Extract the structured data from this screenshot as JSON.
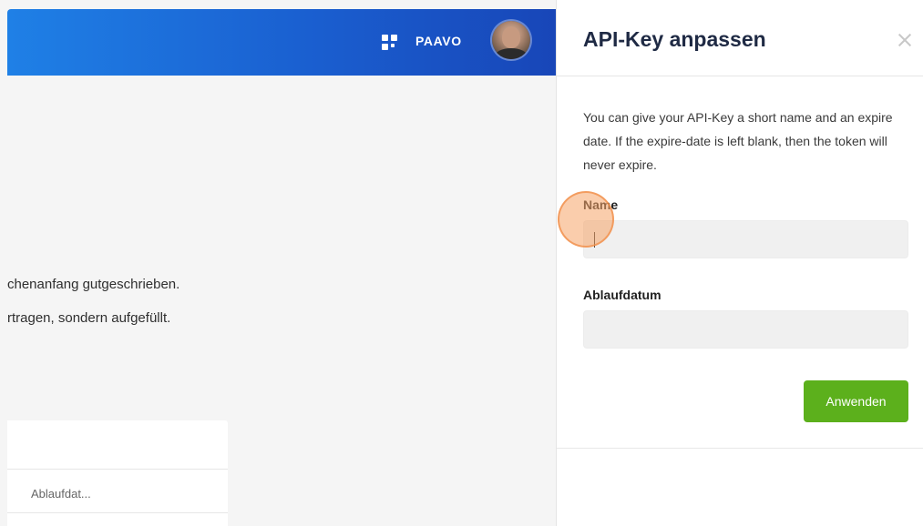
{
  "app": {
    "user_name": "PAAVO",
    "info_lines": [
      "chenanfang gutgeschrieben.",
      "rtragen, sondern aufgefüllt."
    ],
    "table": {
      "column_header": "Ablaufdat..."
    }
  },
  "drawer": {
    "title": "API-Key anpassen",
    "description": "You can give your API-Key a short name and an expire date. If the expire-date is left blank, then the token will never expire.",
    "name_label": "Name",
    "name_value": "",
    "expiry_label": "Ablaufdatum",
    "expiry_value": "",
    "apply_button": "Anwenden"
  },
  "colors": {
    "header_gradient_start": "#1f80e6",
    "header_gradient_end": "#1846b8",
    "apply_button": "#5cb01c",
    "click_indicator": "#f6a468"
  },
  "icons": {
    "apps": "apps-grid-icon",
    "close": "close-icon",
    "avatar": "user-avatar"
  }
}
